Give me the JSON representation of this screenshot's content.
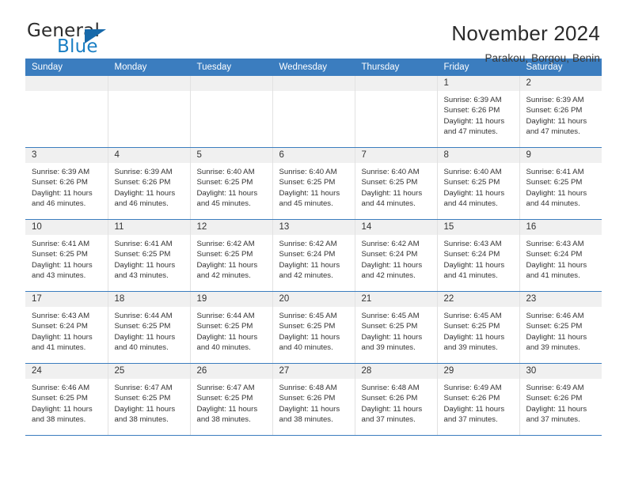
{
  "logo": {
    "name_part1": "General",
    "name_part2": "Blue",
    "icon": "triangle-icon",
    "colors": {
      "blue": "#1a7fc4",
      "dark": "#2b2b2b",
      "triangle": "#1769aa"
    }
  },
  "header": {
    "title": "November 2024",
    "subtitle": "Parakou, Borgou, Benin"
  },
  "theme": {
    "header_blue": "#3b7dbf",
    "daynum_band": "#f0f0f0",
    "text": "#333333"
  },
  "weekday_headers": [
    "Sunday",
    "Monday",
    "Tuesday",
    "Wednesday",
    "Thursday",
    "Friday",
    "Saturday"
  ],
  "labels": {
    "sunrise_prefix": "Sunrise: ",
    "sunset_prefix": "Sunset: ",
    "daylight_prefix": "Daylight: "
  },
  "weeks": [
    [
      {
        "day": "",
        "empty": true
      },
      {
        "day": "",
        "empty": true
      },
      {
        "day": "",
        "empty": true
      },
      {
        "day": "",
        "empty": true
      },
      {
        "day": "",
        "empty": true
      },
      {
        "day": "1",
        "sunrise": "Sunrise: 6:39 AM",
        "sunset": "Sunset: 6:26 PM",
        "daylight_line1": "Daylight: 11 hours",
        "daylight_line2": "and 47 minutes."
      },
      {
        "day": "2",
        "sunrise": "Sunrise: 6:39 AM",
        "sunset": "Sunset: 6:26 PM",
        "daylight_line1": "Daylight: 11 hours",
        "daylight_line2": "and 47 minutes."
      }
    ],
    [
      {
        "day": "3",
        "sunrise": "Sunrise: 6:39 AM",
        "sunset": "Sunset: 6:26 PM",
        "daylight_line1": "Daylight: 11 hours",
        "daylight_line2": "and 46 minutes."
      },
      {
        "day": "4",
        "sunrise": "Sunrise: 6:39 AM",
        "sunset": "Sunset: 6:26 PM",
        "daylight_line1": "Daylight: 11 hours",
        "daylight_line2": "and 46 minutes."
      },
      {
        "day": "5",
        "sunrise": "Sunrise: 6:40 AM",
        "sunset": "Sunset: 6:25 PM",
        "daylight_line1": "Daylight: 11 hours",
        "daylight_line2": "and 45 minutes."
      },
      {
        "day": "6",
        "sunrise": "Sunrise: 6:40 AM",
        "sunset": "Sunset: 6:25 PM",
        "daylight_line1": "Daylight: 11 hours",
        "daylight_line2": "and 45 minutes."
      },
      {
        "day": "7",
        "sunrise": "Sunrise: 6:40 AM",
        "sunset": "Sunset: 6:25 PM",
        "daylight_line1": "Daylight: 11 hours",
        "daylight_line2": "and 44 minutes."
      },
      {
        "day": "8",
        "sunrise": "Sunrise: 6:40 AM",
        "sunset": "Sunset: 6:25 PM",
        "daylight_line1": "Daylight: 11 hours",
        "daylight_line2": "and 44 minutes."
      },
      {
        "day": "9",
        "sunrise": "Sunrise: 6:41 AM",
        "sunset": "Sunset: 6:25 PM",
        "daylight_line1": "Daylight: 11 hours",
        "daylight_line2": "and 44 minutes."
      }
    ],
    [
      {
        "day": "10",
        "sunrise": "Sunrise: 6:41 AM",
        "sunset": "Sunset: 6:25 PM",
        "daylight_line1": "Daylight: 11 hours",
        "daylight_line2": "and 43 minutes."
      },
      {
        "day": "11",
        "sunrise": "Sunrise: 6:41 AM",
        "sunset": "Sunset: 6:25 PM",
        "daylight_line1": "Daylight: 11 hours",
        "daylight_line2": "and 43 minutes."
      },
      {
        "day": "12",
        "sunrise": "Sunrise: 6:42 AM",
        "sunset": "Sunset: 6:25 PM",
        "daylight_line1": "Daylight: 11 hours",
        "daylight_line2": "and 42 minutes."
      },
      {
        "day": "13",
        "sunrise": "Sunrise: 6:42 AM",
        "sunset": "Sunset: 6:24 PM",
        "daylight_line1": "Daylight: 11 hours",
        "daylight_line2": "and 42 minutes."
      },
      {
        "day": "14",
        "sunrise": "Sunrise: 6:42 AM",
        "sunset": "Sunset: 6:24 PM",
        "daylight_line1": "Daylight: 11 hours",
        "daylight_line2": "and 42 minutes."
      },
      {
        "day": "15",
        "sunrise": "Sunrise: 6:43 AM",
        "sunset": "Sunset: 6:24 PM",
        "daylight_line1": "Daylight: 11 hours",
        "daylight_line2": "and 41 minutes."
      },
      {
        "day": "16",
        "sunrise": "Sunrise: 6:43 AM",
        "sunset": "Sunset: 6:24 PM",
        "daylight_line1": "Daylight: 11 hours",
        "daylight_line2": "and 41 minutes."
      }
    ],
    [
      {
        "day": "17",
        "sunrise": "Sunrise: 6:43 AM",
        "sunset": "Sunset: 6:24 PM",
        "daylight_line1": "Daylight: 11 hours",
        "daylight_line2": "and 41 minutes."
      },
      {
        "day": "18",
        "sunrise": "Sunrise: 6:44 AM",
        "sunset": "Sunset: 6:25 PM",
        "daylight_line1": "Daylight: 11 hours",
        "daylight_line2": "and 40 minutes."
      },
      {
        "day": "19",
        "sunrise": "Sunrise: 6:44 AM",
        "sunset": "Sunset: 6:25 PM",
        "daylight_line1": "Daylight: 11 hours",
        "daylight_line2": "and 40 minutes."
      },
      {
        "day": "20",
        "sunrise": "Sunrise: 6:45 AM",
        "sunset": "Sunset: 6:25 PM",
        "daylight_line1": "Daylight: 11 hours",
        "daylight_line2": "and 40 minutes."
      },
      {
        "day": "21",
        "sunrise": "Sunrise: 6:45 AM",
        "sunset": "Sunset: 6:25 PM",
        "daylight_line1": "Daylight: 11 hours",
        "daylight_line2": "and 39 minutes."
      },
      {
        "day": "22",
        "sunrise": "Sunrise: 6:45 AM",
        "sunset": "Sunset: 6:25 PM",
        "daylight_line1": "Daylight: 11 hours",
        "daylight_line2": "and 39 minutes."
      },
      {
        "day": "23",
        "sunrise": "Sunrise: 6:46 AM",
        "sunset": "Sunset: 6:25 PM",
        "daylight_line1": "Daylight: 11 hours",
        "daylight_line2": "and 39 minutes."
      }
    ],
    [
      {
        "day": "24",
        "sunrise": "Sunrise: 6:46 AM",
        "sunset": "Sunset: 6:25 PM",
        "daylight_line1": "Daylight: 11 hours",
        "daylight_line2": "and 38 minutes."
      },
      {
        "day": "25",
        "sunrise": "Sunrise: 6:47 AM",
        "sunset": "Sunset: 6:25 PM",
        "daylight_line1": "Daylight: 11 hours",
        "daylight_line2": "and 38 minutes."
      },
      {
        "day": "26",
        "sunrise": "Sunrise: 6:47 AM",
        "sunset": "Sunset: 6:25 PM",
        "daylight_line1": "Daylight: 11 hours",
        "daylight_line2": "and 38 minutes."
      },
      {
        "day": "27",
        "sunrise": "Sunrise: 6:48 AM",
        "sunset": "Sunset: 6:26 PM",
        "daylight_line1": "Daylight: 11 hours",
        "daylight_line2": "and 38 minutes."
      },
      {
        "day": "28",
        "sunrise": "Sunrise: 6:48 AM",
        "sunset": "Sunset: 6:26 PM",
        "daylight_line1": "Daylight: 11 hours",
        "daylight_line2": "and 37 minutes."
      },
      {
        "day": "29",
        "sunrise": "Sunrise: 6:49 AM",
        "sunset": "Sunset: 6:26 PM",
        "daylight_line1": "Daylight: 11 hours",
        "daylight_line2": "and 37 minutes."
      },
      {
        "day": "30",
        "sunrise": "Sunrise: 6:49 AM",
        "sunset": "Sunset: 6:26 PM",
        "daylight_line1": "Daylight: 11 hours",
        "daylight_line2": "and 37 minutes."
      }
    ]
  ]
}
